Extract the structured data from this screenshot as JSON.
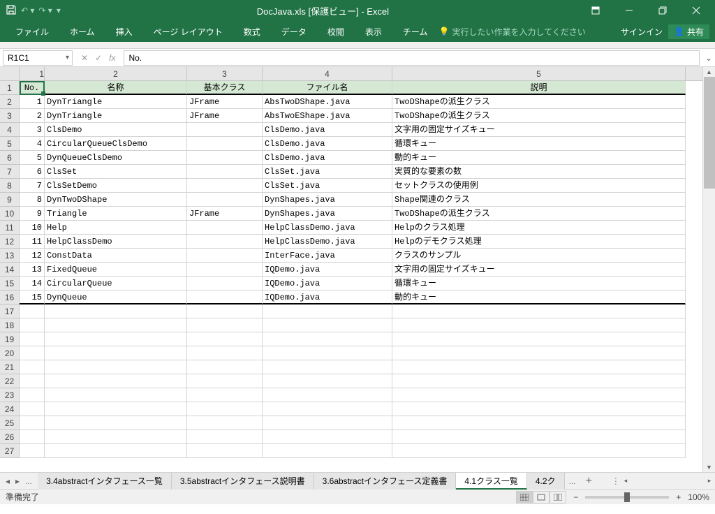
{
  "title": "DocJava.xls  [保護ビュー] - Excel",
  "qat": {
    "save": "save-icon",
    "undo": "undo-icon",
    "redo": "redo-icon"
  },
  "win": {
    "restore_small": "restore-small",
    "minimize": "minimize",
    "restore": "restore",
    "close": "close"
  },
  "ribbon": {
    "tabs": [
      "ファイル",
      "ホーム",
      "挿入",
      "ページ レイアウト",
      "数式",
      "データ",
      "校閲",
      "表示",
      "チーム"
    ],
    "tell_me": "実行したい作業を入力してください",
    "signin": "サインイン",
    "share": "共有"
  },
  "name_box": "R1C1",
  "formula": "No.",
  "columns": [
    {
      "num": "1",
      "w": "c1"
    },
    {
      "num": "2",
      "w": "c2"
    },
    {
      "num": "3",
      "w": "c3"
    },
    {
      "num": "4",
      "w": "c4"
    },
    {
      "num": "5",
      "w": "c5"
    }
  ],
  "header_row": [
    "No.",
    "名称",
    "基本クラス",
    "ファイル名",
    "説明"
  ],
  "rows": [
    {
      "n": "1",
      "c": [
        "1",
        "DynTriangle",
        "JFrame",
        "AbsTwoDShape.java",
        "TwoDShapeの派生クラス"
      ]
    },
    {
      "n": "2",
      "c": [
        "2",
        "DynTriangle",
        "JFrame",
        "AbsTwoEShape.java",
        "TwoDShapeの派生クラス"
      ]
    },
    {
      "n": "3",
      "c": [
        "3",
        "ClsDemo",
        "",
        "ClsDemo.java",
        "文字用の固定サイズキュー"
      ]
    },
    {
      "n": "4",
      "c": [
        "4",
        "CircularQueueClsDemo",
        "",
        "ClsDemo.java",
        "循環キュー"
      ]
    },
    {
      "n": "5",
      "c": [
        "5",
        "DynQueueClsDemo",
        "",
        "ClsDemo.java",
        "動的キュー"
      ]
    },
    {
      "n": "6",
      "c": [
        "6",
        "ClsSet",
        "",
        "ClsSet.java",
        "実質的な要素の数"
      ]
    },
    {
      "n": "7",
      "c": [
        "7",
        "ClsSetDemo",
        "",
        "ClsSet.java",
        "セットクラスの使用例"
      ]
    },
    {
      "n": "8",
      "c": [
        "8",
        "DynTwoDShape",
        "",
        "DynShapes.java",
        "Shape関連のクラス"
      ]
    },
    {
      "n": "9",
      "c": [
        "9",
        "Triangle",
        "JFrame",
        "DynShapes.java",
        "TwoDShapeの派生クラス"
      ]
    },
    {
      "n": "10",
      "c": [
        "10",
        "Help",
        "",
        "HelpClassDemo.java",
        "Helpのクラス処理"
      ]
    },
    {
      "n": "11",
      "c": [
        "11",
        "HelpClassDemo",
        "",
        "HelpClassDemo.java",
        "Helpのデモクラス処理"
      ]
    },
    {
      "n": "12",
      "c": [
        "12",
        "ConstData",
        "",
        "InterFace.java",
        "クラスのサンプル"
      ]
    },
    {
      "n": "13",
      "c": [
        "13",
        "FixedQueue",
        "",
        "IQDemo.java",
        "文字用の固定サイズキュー"
      ]
    },
    {
      "n": "14",
      "c": [
        "14",
        "CircularQueue",
        "",
        "IQDemo.java",
        "循環キュー"
      ]
    },
    {
      "n": "15",
      "c": [
        "15",
        "DynQueue",
        "",
        "IQDemo.java",
        "動的キュー"
      ]
    }
  ],
  "empty_rows": [
    "17",
    "18",
    "19",
    "20",
    "21",
    "22",
    "23",
    "24",
    "25",
    "26",
    "27"
  ],
  "sheet_tabs": [
    {
      "label": "3.4abstractインタフェース一覧",
      "active": false
    },
    {
      "label": "3.5abstractインタフェース説明書",
      "active": false
    },
    {
      "label": "3.6abstractインタフェース定義書",
      "active": false
    },
    {
      "label": "4.1クラス一覧",
      "active": true
    },
    {
      "label": "4.2ク",
      "active": false
    }
  ],
  "tab_ellipsis": "...",
  "tab_add": "+",
  "status": {
    "ready": "準備完了",
    "zoom": "100%",
    "minus": "−",
    "plus": "+"
  }
}
